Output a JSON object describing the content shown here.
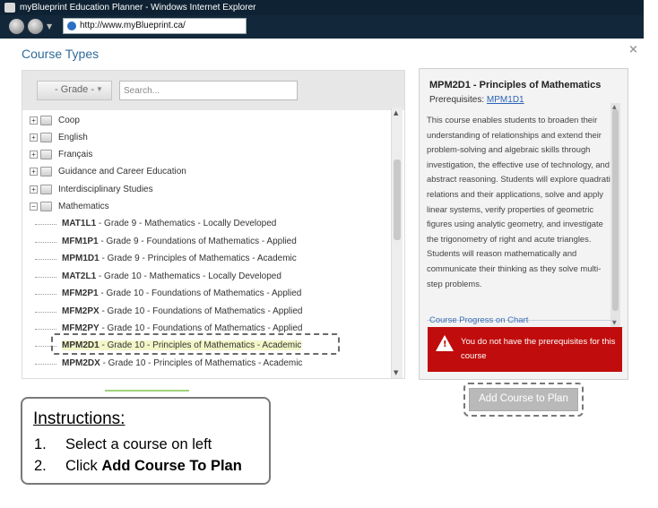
{
  "window": {
    "title": "myBlueprint Education Planner - Windows Internet Explorer",
    "url": "http://www.myBlueprint.ca/"
  },
  "dialog": {
    "heading": "Course Types",
    "close": "×"
  },
  "filters": {
    "grade_label": "- Grade -",
    "search_placeholder": "Search..."
  },
  "tree": {
    "categories": [
      {
        "label": "Coop",
        "toggle": "+"
      },
      {
        "label": "English",
        "toggle": "+"
      },
      {
        "label": "Français",
        "toggle": "+"
      },
      {
        "label": "Guidance and Career Education",
        "toggle": "+"
      },
      {
        "label": "Interdisciplinary Studies",
        "toggle": "+"
      },
      {
        "label": "Mathematics",
        "toggle": "−"
      }
    ],
    "courses": [
      {
        "code": "MAT1L1",
        "desc": " - Grade 9 - Mathematics - Locally Developed"
      },
      {
        "code": "MFM1P1",
        "desc": " - Grade 9 - Foundations of Mathematics - Applied"
      },
      {
        "code": "MPM1D1",
        "desc": " - Grade 9 - Principles of Mathematics - Academic"
      },
      {
        "code": "MAT2L1",
        "desc": " - Grade 10 - Mathematics - Locally Developed"
      },
      {
        "code": "MFM2P1",
        "desc": " - Grade 10 - Foundations of Mathematics - Applied"
      },
      {
        "code": "MFM2PX",
        "desc": " - Grade 10 - Foundations of Mathematics - Applied"
      },
      {
        "code": "MFM2PY",
        "desc": " - Grade 10 - Foundations of Mathematics - Applied"
      },
      {
        "code": "MPM2D1",
        "desc": " - Grade 10 - Principles of Mathematics - Academic",
        "selected": true
      },
      {
        "code": "MPM2DX",
        "desc": " - Grade 10 - Principles of Mathematics - Academic"
      }
    ]
  },
  "detail": {
    "title": "MPM2D1 - Principles of Mathematics",
    "prereq_label": "Prerequisites: ",
    "prereq_link": "MPM1D1",
    "description": "This course enables students to broaden their understanding of relationships and extend their problem-solving and algebraic skills through investigation, the effective use of technology, and abstract reasoning. Students will explore quadratic relations and their applications, solve and apply linear systems, verify properties of geometric figures using analytic geometry, and investigate the trigonometry of right and acute triangles. Students will reason mathematically and communicate their thinking as they solve multi-step problems.",
    "progress_link": "Course Progress on Chart",
    "alert": "You do not have the prerequisites for this course",
    "alert_icon": "warning-icon"
  },
  "actions": {
    "add_course": "Add Course to Plan"
  },
  "instructions": {
    "title": "Instructions:",
    "step1_num": "1.",
    "step1_text": "Select a course on left",
    "step2_num": "2.",
    "step2_prefix": "Click ",
    "step2_bold": "Add Course To Plan"
  },
  "colors": {
    "heading": "#2f6b9a",
    "alert_bg": "#c00c0c",
    "selected_bg": "#f3f7c8",
    "button_bg": "#b9b9b9"
  }
}
